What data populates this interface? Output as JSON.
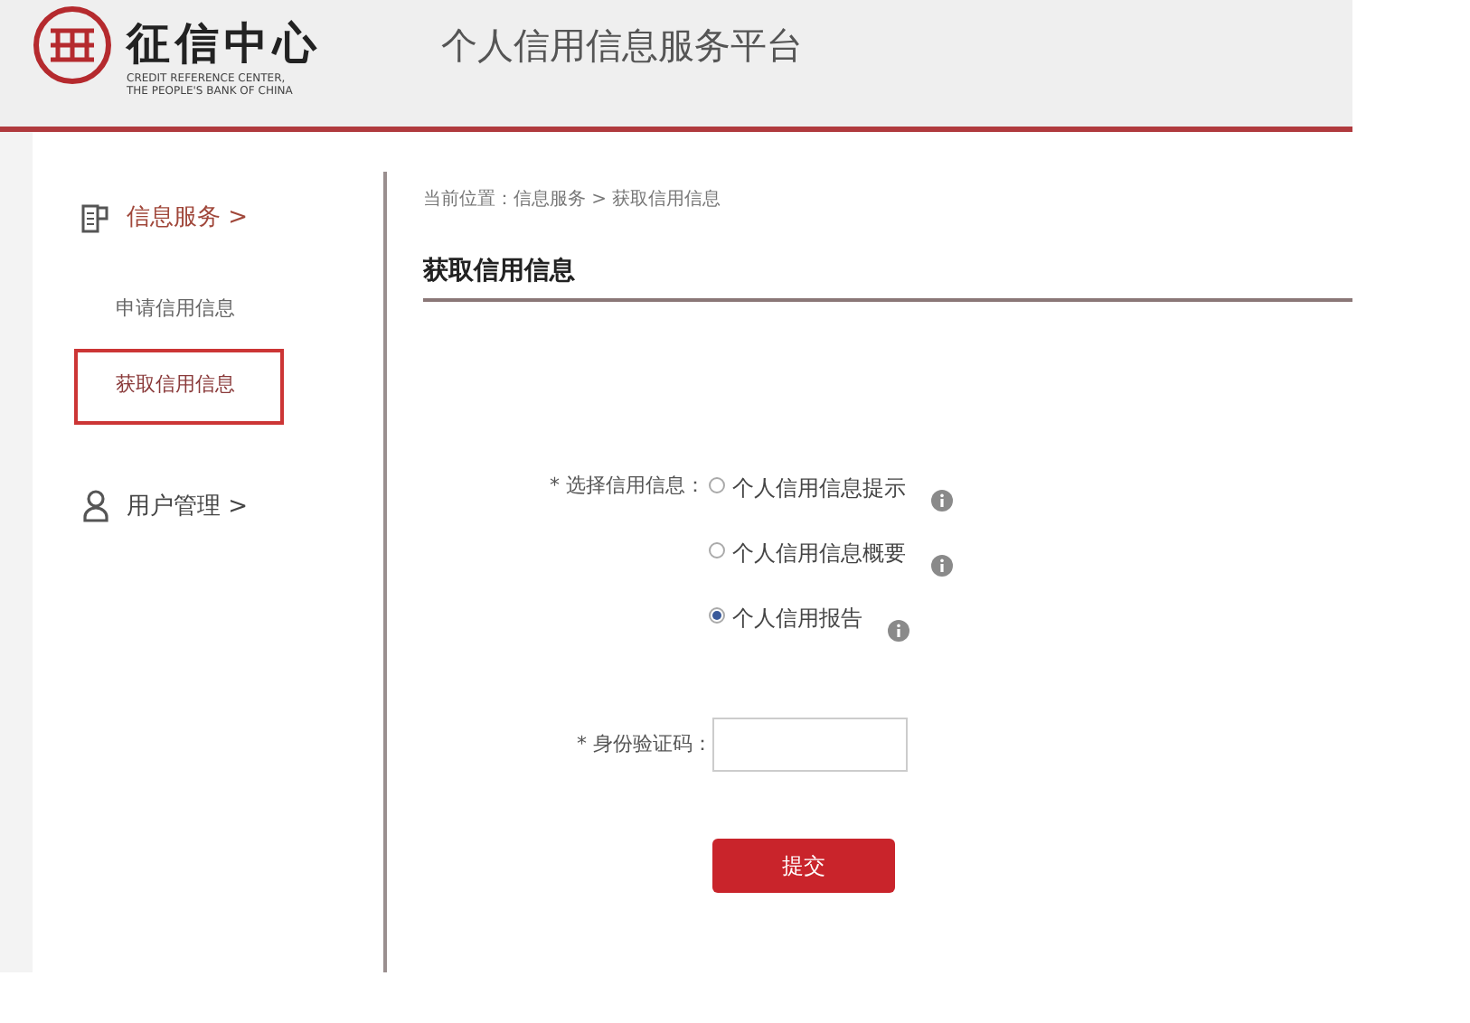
{
  "header": {
    "logo_name": "征信中心",
    "logo_subtitle": [
      "CREDIT REFERENCE  CENTER,",
      "THE PEOPLE'S BANK OF CHINA"
    ],
    "platform_title": "个人信用信息服务平台"
  },
  "sidebar": {
    "sections": [
      {
        "kind": "document",
        "label": "信息服务 >",
        "expanded": true,
        "children": [
          {
            "label": "申请信用信息",
            "selected": false
          },
          {
            "label": "获取信用信息",
            "selected": true
          }
        ]
      },
      {
        "kind": "user",
        "label": "用户管理 >",
        "expanded": false
      }
    ]
  },
  "breadcrumb": "当前位置：信息服务 > 获取信用信息",
  "page_title": "获取信用信息",
  "form": {
    "choice_label": "* 选择信用信息：",
    "options": [
      {
        "label": "个人信用信息提示",
        "selected": false
      },
      {
        "label": "个人信用信息概要",
        "selected": false
      },
      {
        "label": "个人信用报告",
        "selected": true
      }
    ],
    "code_label": "* 身份验证码：",
    "submit": "提交"
  }
}
